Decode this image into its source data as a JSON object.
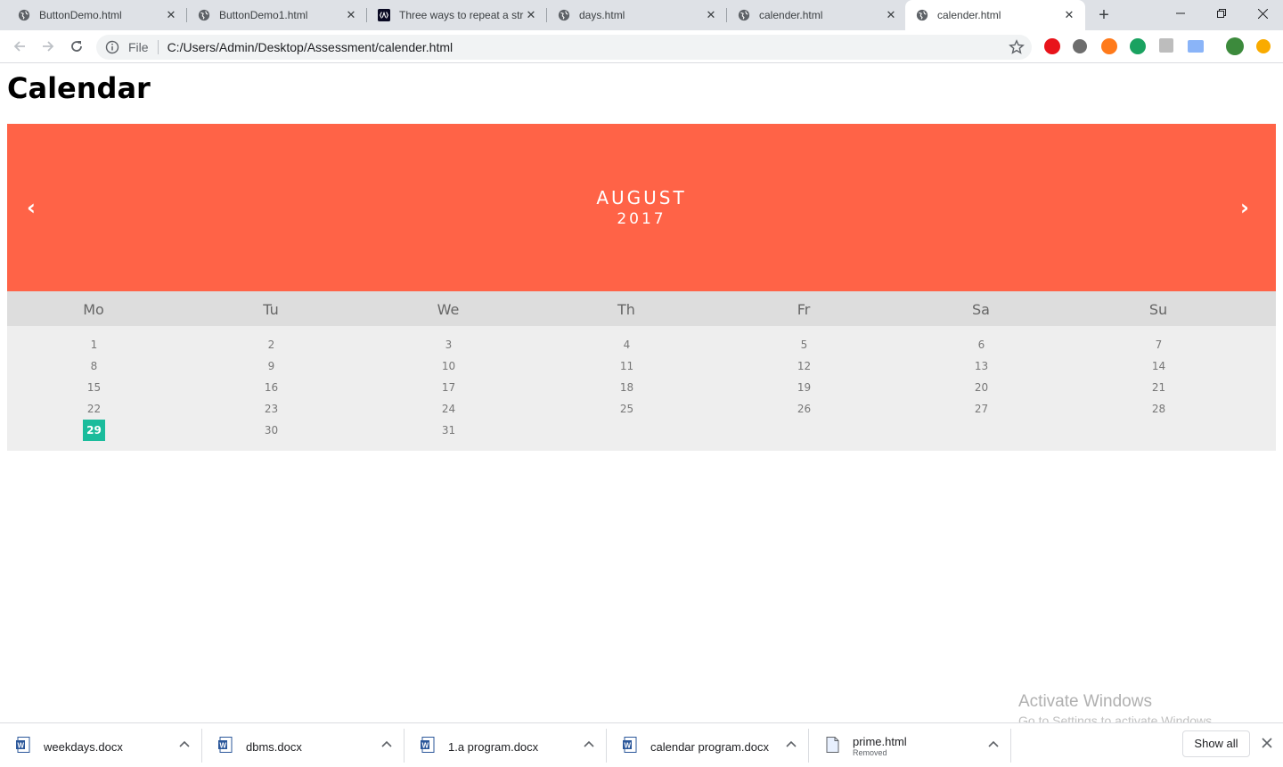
{
  "browser": {
    "tabs": [
      {
        "title": "ButtonDemo.html",
        "icon": "globe-icon",
        "active": false
      },
      {
        "title": "ButtonDemo1.html",
        "icon": "globe-icon",
        "active": false
      },
      {
        "title": "Three ways to repeat a str",
        "icon": "site-logo-icon",
        "active": false
      },
      {
        "title": "days.html",
        "icon": "globe-icon",
        "active": false
      },
      {
        "title": "calender.html",
        "icon": "globe-icon",
        "active": false
      },
      {
        "title": "calender.html",
        "icon": "globe-icon",
        "active": true
      }
    ],
    "address": {
      "scheme_label": "File",
      "url": "C:/Users/Admin/Desktop/Assessment/calender.html"
    }
  },
  "page": {
    "title": "Calendar",
    "accent_color": "#ff6347",
    "today_color": "#1abc9c",
    "month": "AUGUST",
    "year": "2017",
    "prev_symbol": "‹",
    "next_symbol": "›",
    "weekdays": [
      "Mo",
      "Tu",
      "We",
      "Th",
      "Fr",
      "Sa",
      "Su"
    ],
    "days": [
      "1",
      "2",
      "3",
      "4",
      "5",
      "6",
      "7",
      "8",
      "9",
      "10",
      "11",
      "12",
      "13",
      "14",
      "15",
      "16",
      "17",
      "18",
      "19",
      "20",
      "21",
      "22",
      "23",
      "24",
      "25",
      "26",
      "27",
      "28",
      "29",
      "30",
      "31"
    ],
    "today": "29"
  },
  "watermark": {
    "line1": "Activate Windows",
    "line2": "Go to Settings to activate Windows."
  },
  "downloads": {
    "items": [
      {
        "name": "weekdays.docx",
        "sub": "",
        "icon": "word-doc-icon"
      },
      {
        "name": "dbms.docx",
        "sub": "",
        "icon": "word-doc-icon"
      },
      {
        "name": "1.a program.docx",
        "sub": "",
        "icon": "word-doc-icon"
      },
      {
        "name": "calendar program.docx",
        "sub": "",
        "icon": "word-doc-icon"
      },
      {
        "name": "prime.html",
        "sub": "Removed",
        "icon": "file-icon"
      }
    ],
    "show_all": "Show all"
  }
}
